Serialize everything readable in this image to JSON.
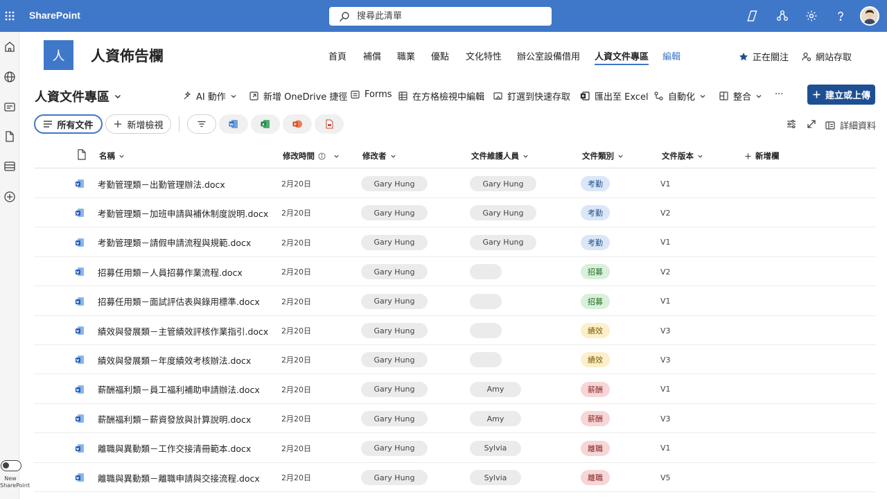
{
  "suite_bar": {
    "app_name": "SharePoint",
    "search_placeholder": "搜尋此清單"
  },
  "site": {
    "logo_letter": "人",
    "title": "人資佈告欄",
    "nav": [
      {
        "label": "首頁",
        "active": false
      },
      {
        "label": "補償",
        "active": false
      },
      {
        "label": "職業",
        "active": false
      },
      {
        "label": "優點",
        "active": false
      },
      {
        "label": "文化特性",
        "active": false
      },
      {
        "label": "辦公室設備借用",
        "active": false
      },
      {
        "label": "人資文件專區",
        "active": true
      },
      {
        "label": "編輯",
        "active": false
      }
    ],
    "follow_label": "正在關注",
    "site_access_label": "網站存取"
  },
  "library": {
    "title": "人資文件專區"
  },
  "commands": {
    "ai": "AI 動作",
    "onedrive": "新增 OneDrive 捷徑",
    "forms": "Forms",
    "grid_edit": "在方格檢視中編輯",
    "pin": "釘選到快速存取",
    "export": "匯出至 Excel",
    "automate": "自動化",
    "integrate": "整合",
    "more": "···",
    "create": "建立或上傳"
  },
  "views": {
    "all_docs": "所有文件",
    "new_view": "新增檢視",
    "details": "詳細資料"
  },
  "new_sharepoint_label": "New SharePoint",
  "columns": {
    "name": "名稱",
    "modified": "修改時間",
    "modified_by": "修改者",
    "maintainer": "文件維護人員",
    "category": "文件類別",
    "version": "文件版本",
    "add_column": "新增欄"
  },
  "colors": {
    "accent": "#3f77c9",
    "primary_button": "#1e4f93",
    "tag_attendance_bg": "#dbe7f7",
    "tag_recruit_bg": "#d9f0d9",
    "tag_perf_bg": "#fcefc9",
    "tag_pay_bg": "#f6d6d6",
    "tag_leave_bg": "#f6d6d6"
  },
  "rows": [
    {
      "name": "考勤管理類－出勤管理辦法.docx",
      "modified": "2月20日",
      "modified_by": "Gary Hung",
      "maintainer": "Gary Hung",
      "category": "考勤",
      "category_bg": "#dbe7f7",
      "category_fg": "#1f4e8c",
      "version": "V1"
    },
    {
      "name": "考勤管理類－加班申請與補休制度說明.docx",
      "modified": "2月20日",
      "modified_by": "Gary Hung",
      "maintainer": "Gary Hung",
      "category": "考勤",
      "category_bg": "#dbe7f7",
      "category_fg": "#1f4e8c",
      "version": "V2"
    },
    {
      "name": "考勤管理類－請假申請流程與規範.docx",
      "modified": "2月20日",
      "modified_by": "Gary Hung",
      "maintainer": "Gary Hung",
      "category": "考勤",
      "category_bg": "#dbe7f7",
      "category_fg": "#1f4e8c",
      "version": "V1"
    },
    {
      "name": "招募任用類－人員招募作業流程.docx",
      "modified": "2月20日",
      "modified_by": "Gary Hung",
      "maintainer": "",
      "category": "招募",
      "category_bg": "#d9f0d9",
      "category_fg": "#216a21",
      "version": "V2"
    },
    {
      "name": "招募任用類－面試評估表與錄用標準.docx",
      "modified": "2月20日",
      "modified_by": "Gary Hung",
      "maintainer": "",
      "category": "招募",
      "category_bg": "#d9f0d9",
      "category_fg": "#216a21",
      "version": "V1"
    },
    {
      "name": "績效與發展類－主管績效評核作業指引.docx",
      "modified": "2月20日",
      "modified_by": "Gary Hung",
      "maintainer": "",
      "category": "績效",
      "category_bg": "#fcefc9",
      "category_fg": "#7a5a00",
      "version": "V3"
    },
    {
      "name": "績效與發展類－年度績效考核辦法.docx",
      "modified": "2月20日",
      "modified_by": "Gary Hung",
      "maintainer": "",
      "category": "績效",
      "category_bg": "#fcefc9",
      "category_fg": "#7a5a00",
      "version": "V3"
    },
    {
      "name": "薪酬福利類－員工福利補助申請辦法.docx",
      "modified": "2月20日",
      "modified_by": "Gary Hung",
      "maintainer": "Amy",
      "category": "薪酬",
      "category_bg": "#f6d6d6",
      "category_fg": "#8a2424",
      "version": "V1"
    },
    {
      "name": "薪酬福利類－薪資發放與計算說明.docx",
      "modified": "2月20日",
      "modified_by": "Gary Hung",
      "maintainer": "Amy",
      "category": "薪酬",
      "category_bg": "#f6d6d6",
      "category_fg": "#8a2424",
      "version": "V3"
    },
    {
      "name": "離職與異動類－工作交接清冊範本.docx",
      "modified": "2月20日",
      "modified_by": "Gary Hung",
      "maintainer": "Sylvia",
      "category": "離職",
      "category_bg": "#f6d6d6",
      "category_fg": "#8a2424",
      "version": "V1"
    },
    {
      "name": "離職與異動類－離職申請與交接流程.docx",
      "modified": "2月20日",
      "modified_by": "Gary Hung",
      "maintainer": "Sylvia",
      "category": "離職",
      "category_bg": "#f6d6d6",
      "category_fg": "#8a2424",
      "version": "V5"
    }
  ]
}
